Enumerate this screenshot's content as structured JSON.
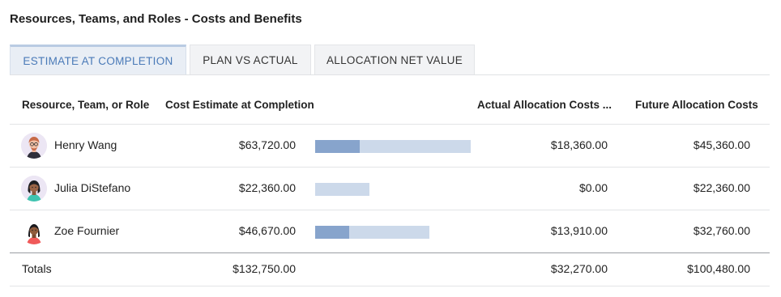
{
  "page_title": "Resources, Teams, and Roles - Costs and Benefits",
  "tabs": [
    {
      "label": "ESTIMATE AT COMPLETION",
      "active": true
    },
    {
      "label": "PLAN VS ACTUAL",
      "active": false
    },
    {
      "label": "ALLOCATION NET VALUE",
      "active": false
    }
  ],
  "columns": {
    "resource": "Resource, Team, or Role",
    "estimate": "Cost Estimate at Completion",
    "actual": "Actual Allocation Costs ...",
    "future": "Future Allocation Costs"
  },
  "rows": [
    {
      "name": "Henry Wang",
      "avatar": "avatar-henry",
      "estimate": "$63,720.00",
      "actual": "$18,360.00",
      "future": "$45,360.00",
      "estimate_value": 63720,
      "actual_value": 18360
    },
    {
      "name": "Julia DiStefano",
      "avatar": "avatar-julia",
      "estimate": "$22,360.00",
      "actual": "$0.00",
      "future": "$22,360.00",
      "estimate_value": 22360,
      "actual_value": 0
    },
    {
      "name": "Zoe Fournier",
      "avatar": "avatar-zoe",
      "estimate": "$46,670.00",
      "actual": "$13,910.00",
      "future": "$32,760.00",
      "estimate_value": 46670,
      "actual_value": 13910
    }
  ],
  "totals": {
    "label": "Totals",
    "estimate": "$132,750.00",
    "actual": "$32,270.00",
    "future": "$100,480.00"
  },
  "colors": {
    "accent": "#4a7ab8",
    "bar_estimate": "#ccd9ea",
    "bar_actual": "#87a4cc"
  }
}
